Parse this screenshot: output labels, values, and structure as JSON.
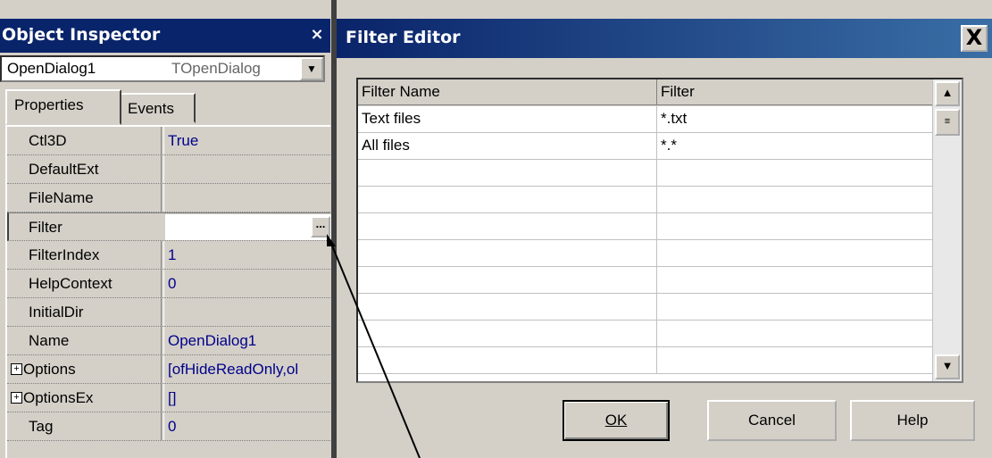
{
  "object_inspector": {
    "title": "Object Inspector",
    "close_glyph": "×",
    "component_name": "OpenDialog1",
    "component_type": "TOpenDialog",
    "dropdown_glyph": "▼",
    "tabs": [
      "Properties",
      "Events"
    ],
    "properties": [
      {
        "name": "Ctl3D",
        "value": "True"
      },
      {
        "name": "DefaultExt",
        "value": ""
      },
      {
        "name": "FileName",
        "value": ""
      },
      {
        "name": "Filter",
        "value": ""
      },
      {
        "name": "FilterIndex",
        "value": "1"
      },
      {
        "name": "HelpContext",
        "value": "0"
      },
      {
        "name": "InitialDir",
        "value": ""
      },
      {
        "name": "Name",
        "value": "OpenDialog1"
      },
      {
        "name": "Options",
        "value": "[ofHideReadOnly,ol"
      },
      {
        "name": "OptionsEx",
        "value": "[]"
      },
      {
        "name": "Tag",
        "value": "0"
      }
    ],
    "expand_glyph": "+",
    "ellipsis_glyph": "..."
  },
  "filter_editor": {
    "title": "Filter Editor",
    "close_glyph": "X",
    "columns": [
      "Filter Name",
      "Filter"
    ],
    "rows": [
      {
        "name": "Text files",
        "filter": "*.txt"
      },
      {
        "name": "All files",
        "filter": "*.*"
      }
    ],
    "scroll_up_glyph": "▲",
    "scroll_down_glyph": "▼",
    "thumb_glyph": "≡",
    "buttons": {
      "ok": "OK",
      "cancel": "Cancel",
      "help": "Help"
    }
  },
  "colors": {
    "title_bar": "#0a246a",
    "face": "#d4d0c8",
    "value_text": "#00008b"
  }
}
